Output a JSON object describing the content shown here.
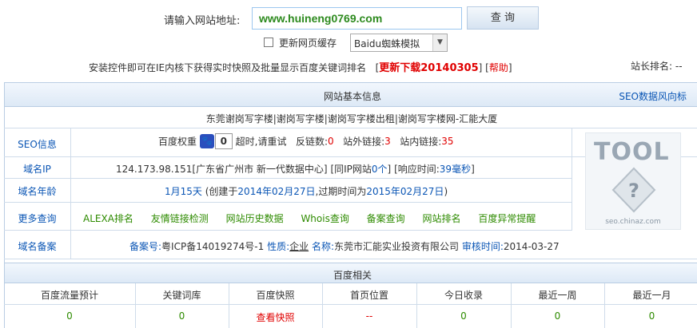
{
  "search": {
    "label": "请输入网站地址:",
    "value": "www.huineng0769.com",
    "button": "查 询",
    "cache_label": "更新网页缓存",
    "ua_selected": "Baidu蜘蛛模拟"
  },
  "notice": {
    "text": "安装控件即可在IE内核下获得实时快照及批量显示百度关键词排名",
    "download": "更新下载20140305",
    "help": "帮助",
    "rank_label": "站长排名:",
    "rank_value": "--"
  },
  "basic": {
    "title": "网站基本信息",
    "seo_link": "SEO数据风向标",
    "site_title": "东莞谢岗写字楼|谢岗写字楼|谢岗写字楼出租|谢岗写字楼网-汇能大厦",
    "seo": {
      "label": "SEO信息",
      "pw_label": "百度权重",
      "pw_value": "0",
      "timeout": "超时,请重试",
      "backlinks_label": "反链数:",
      "backlinks_value": "0",
      "outlinks_label": "站外链接:",
      "outlinks_value": "3",
      "inlinks_label": "站内链接:",
      "inlinks_value": "35"
    },
    "ip": {
      "label": "域名IP",
      "value": "124.173.98.151[广东省广州市 新一代数据中心]",
      "same_ip_prefix": "[同IP网站",
      "same_ip_value": "0个",
      "same_ip_suffix": "]",
      "resp_prefix": "[响应时间:",
      "resp_value": "39毫秒",
      "resp_suffix": "]"
    },
    "age": {
      "label": "域名年龄",
      "age": "1月15天",
      "created_prefix": "(创建于",
      "created": "2014年02月27日",
      "expire_prefix": ",过期时间为",
      "expire": "2015年02月27日",
      "suffix": ")"
    },
    "more": {
      "label": "更多查询",
      "links": [
        "ALEXA排名",
        "友情链接检测",
        "网站历史数据",
        "Whois查询",
        "备案查询",
        "网站排名",
        "百度异常提醒"
      ]
    },
    "icp": {
      "label": "域名备案",
      "no_label": "备案号:",
      "no_value": "粤ICP备14019274号-1",
      "nature_label": "性质:",
      "nature_value": "企业",
      "name_label": "名称:",
      "name_value": "东莞市汇能实业投资有限公司",
      "audit_label": "审核时间:",
      "audit_value": "2014-03-27"
    },
    "logo": {
      "word": "TOOL",
      "caption": "seo.chinaz.com"
    }
  },
  "baidu": {
    "title": "百度相关",
    "headers": [
      "百度流量预计",
      "关键词库",
      "百度快照",
      "首页位置",
      "今日收录",
      "最近一周",
      "最近一月"
    ],
    "values": [
      "0",
      "0",
      "查看快照",
      "--",
      "0",
      "0",
      "0"
    ]
  },
  "colors": {
    "link": "#0b56b5",
    "accent_red": "#e00000",
    "green": "#2e8b00",
    "header_bg": "#dde9f6"
  }
}
